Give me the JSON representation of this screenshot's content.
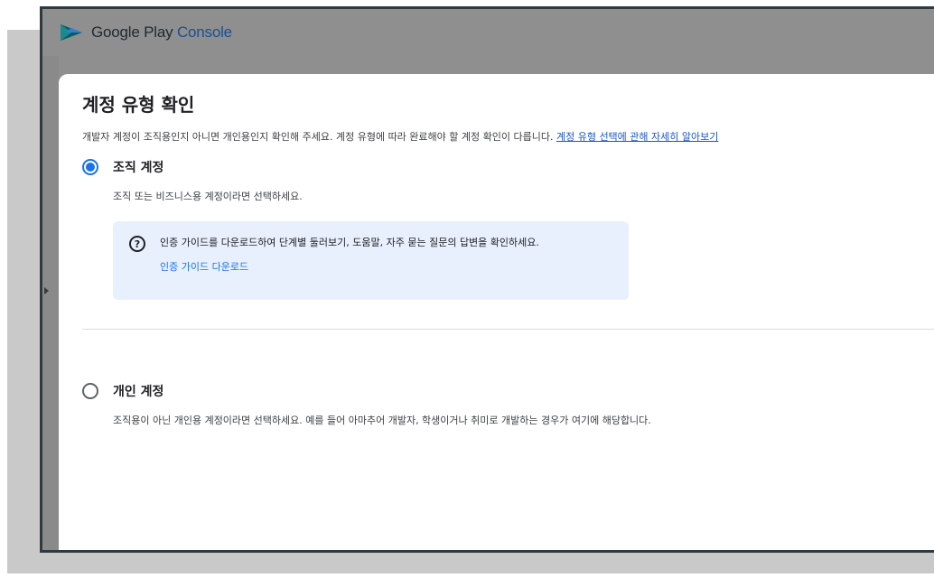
{
  "app": {
    "brand_google_play": "Google Play ",
    "brand_console": "Console"
  },
  "dialog": {
    "title": "계정 유형 확인",
    "description": "개발자 계정이 조직용인지 아니면 개인용인지 확인해 주세요. 계정 유형에 따라 완료해야 할 계정 확인이 다릅니다. ",
    "learn_more_link": "계정 유형 선택에 관해 자세히 알아보기",
    "options": [
      {
        "label": "조직 계정",
        "subtext": "조직 또는 비즈니스용 계정이라면 선택하세요.",
        "selected": true
      },
      {
        "label": "개인 계정",
        "subtext": "조직용이 아닌 개인용 계정이라면 선택하세요. 예를 들어 아마추어 개발자, 학생이거나 취미로 개발하는 경우가 여기에 해당합니다.",
        "selected": false
      }
    ],
    "info_box": {
      "icon": "help-circle-icon",
      "text": "인증 가이드를 다운로드하여 단계별 둘러보기, 도움말, 자주 묻는 질문의 답변을 확인하세요.",
      "link": "인증 가이드 다운로드"
    }
  },
  "colors": {
    "accent": "#1a73e8",
    "info_bg": "#e8f0fe",
    "link": "#1a56c8"
  }
}
